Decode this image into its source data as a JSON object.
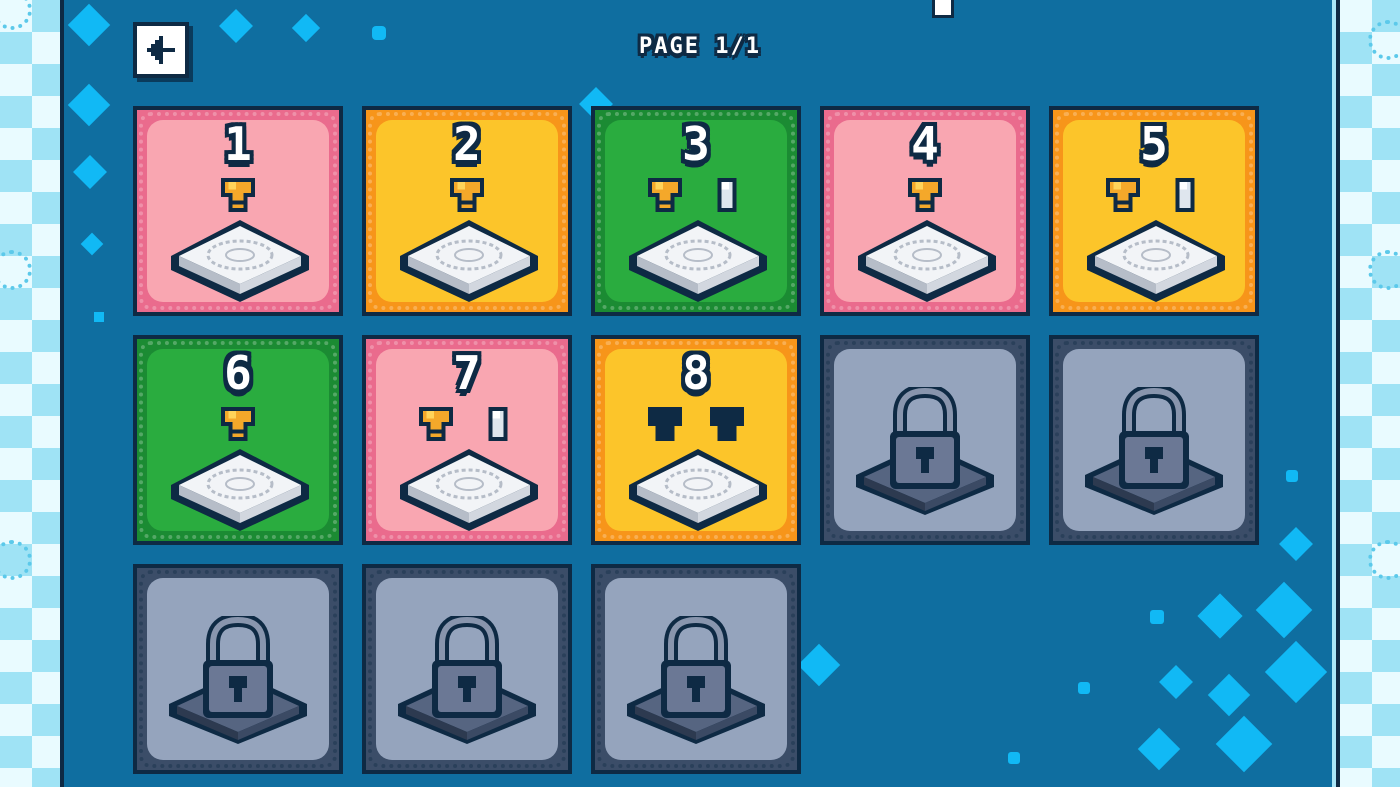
{
  "header": {
    "page_label": "PAGE 1/1",
    "back_icon": "arrow-left-icon"
  },
  "colors": {
    "panel": "#0f6ea0",
    "pink": "#f9a6b1",
    "yellow": "#fcc52a",
    "green": "#2aac3f",
    "locked": "#95a4bd",
    "outline": "#0e2a44"
  },
  "levels": [
    {
      "label": "1",
      "color": "pink",
      "locked": false,
      "trophy": "gold",
      "extra": null
    },
    {
      "label": "2",
      "color": "yellow",
      "locked": false,
      "trophy": "gold",
      "extra": null
    },
    {
      "label": "3",
      "color": "green",
      "locked": false,
      "trophy": "gold",
      "extra": "silver"
    },
    {
      "label": "4",
      "color": "pink",
      "locked": false,
      "trophy": "gold",
      "extra": null
    },
    {
      "label": "5",
      "color": "yellow",
      "locked": false,
      "trophy": "gold",
      "extra": "silver"
    },
    {
      "label": "6",
      "color": "green",
      "locked": false,
      "trophy": "gold",
      "extra": null
    },
    {
      "label": "7",
      "color": "pink",
      "locked": false,
      "trophy": "gold",
      "extra": "silver"
    },
    {
      "label": "8",
      "color": "yellow",
      "locked": false,
      "trophy": "empty",
      "extra": "empty"
    },
    {
      "label": "",
      "color": "locked",
      "locked": true,
      "trophy": null,
      "extra": null
    },
    {
      "label": "",
      "color": "locked",
      "locked": true,
      "trophy": null,
      "extra": null
    },
    {
      "label": "",
      "color": "locked",
      "locked": true,
      "trophy": null,
      "extra": null
    },
    {
      "label": "",
      "color": "locked",
      "locked": true,
      "trophy": null,
      "extra": null
    },
    {
      "label": "",
      "color": "locked",
      "locked": true,
      "trophy": null,
      "extra": null
    }
  ]
}
